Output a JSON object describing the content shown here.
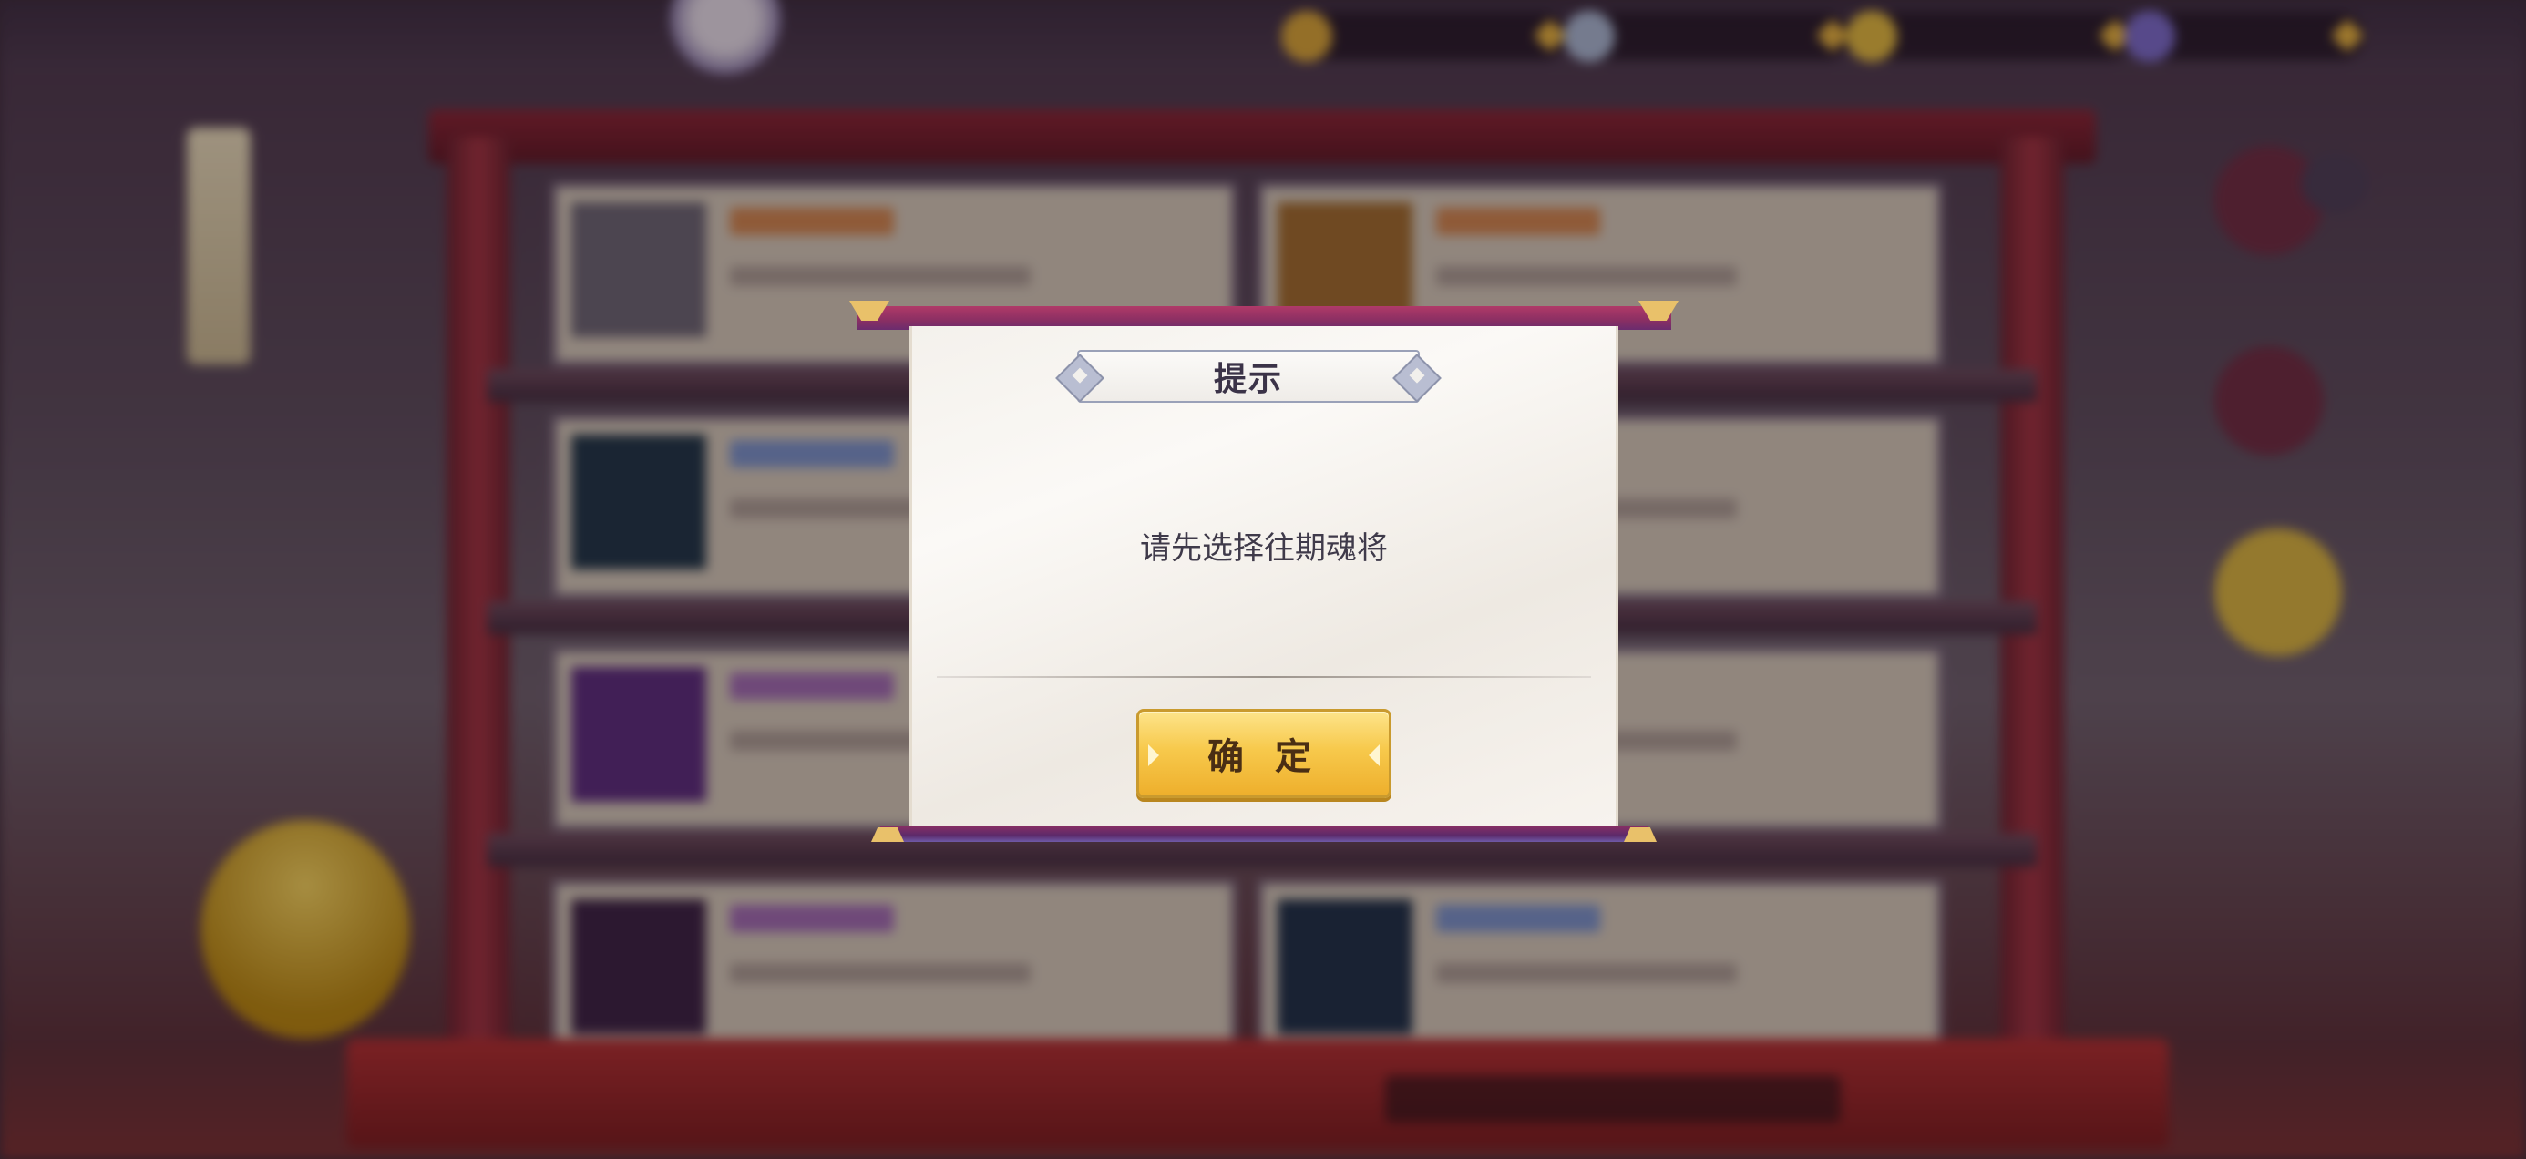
{
  "dialog": {
    "title": "提示",
    "message": "请先选择往期魂将",
    "confirm_label": "确 定"
  },
  "colors": {
    "dialog_frame": "#8a2f63",
    "button_gold": "#f7c94c",
    "panel_bg": "#f4f1ec",
    "text_dark": "#3b3348"
  },
  "icons": [
    "coin-icon",
    "silver-icon",
    "gold-ingot-icon",
    "gem-icon",
    "chat-bubble-icon"
  ]
}
